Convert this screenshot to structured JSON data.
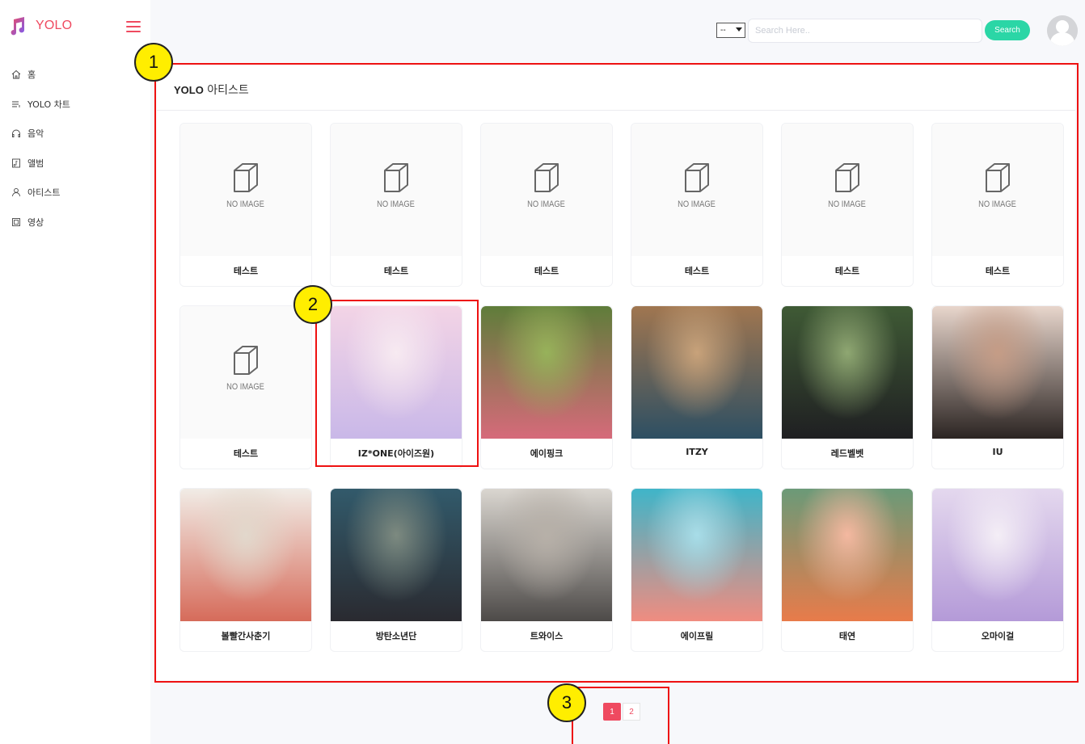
{
  "app": {
    "brand": "YOLO"
  },
  "sidebar": {
    "items": [
      {
        "label": "홈",
        "icon": "home-icon"
      },
      {
        "label": "YOLO 차트",
        "icon": "chart-icon"
      },
      {
        "label": "음악",
        "icon": "headphones-icon"
      },
      {
        "label": "앨범",
        "icon": "album-icon"
      },
      {
        "label": "아티스트",
        "icon": "person-icon"
      },
      {
        "label": "영상",
        "icon": "video-icon"
      }
    ]
  },
  "header": {
    "select_value": "--",
    "search_placeholder": "Search Here..",
    "search_button": "Search"
  },
  "content": {
    "title_bold": "YOLO",
    "title_rest": "아티스트",
    "no_image_text": "NO IMAGE",
    "artists": [
      {
        "name": "테스트",
        "image": "none"
      },
      {
        "name": "테스트",
        "image": "none"
      },
      {
        "name": "테스트",
        "image": "none"
      },
      {
        "name": "테스트",
        "image": "none"
      },
      {
        "name": "테스트",
        "image": "none"
      },
      {
        "name": "테스트",
        "image": "none"
      },
      {
        "name": "테스트",
        "image": "none"
      },
      {
        "name": "IZ*ONE(아이즈원)",
        "image": "photo"
      },
      {
        "name": "에이핑크",
        "image": "photo"
      },
      {
        "name": "ITZY",
        "image": "photo"
      },
      {
        "name": "레드벨벳",
        "image": "photo"
      },
      {
        "name": "IU",
        "image": "photo"
      },
      {
        "name": "볼빨간사춘기",
        "image": "photo"
      },
      {
        "name": "방탄소년단",
        "image": "photo"
      },
      {
        "name": "트와이스",
        "image": "photo"
      },
      {
        "name": "에이프릴",
        "image": "photo"
      },
      {
        "name": "태연",
        "image": "photo"
      },
      {
        "name": "오마이걸",
        "image": "photo"
      }
    ]
  },
  "pagination": {
    "pages": [
      "1",
      "2"
    ],
    "current": "1"
  },
  "annotations": [
    "1",
    "2",
    "3"
  ],
  "colors": {
    "accent": "#ef4a60",
    "search": "#2bd6a6",
    "annotation": "#ee1111",
    "marker": "#ffee00"
  }
}
